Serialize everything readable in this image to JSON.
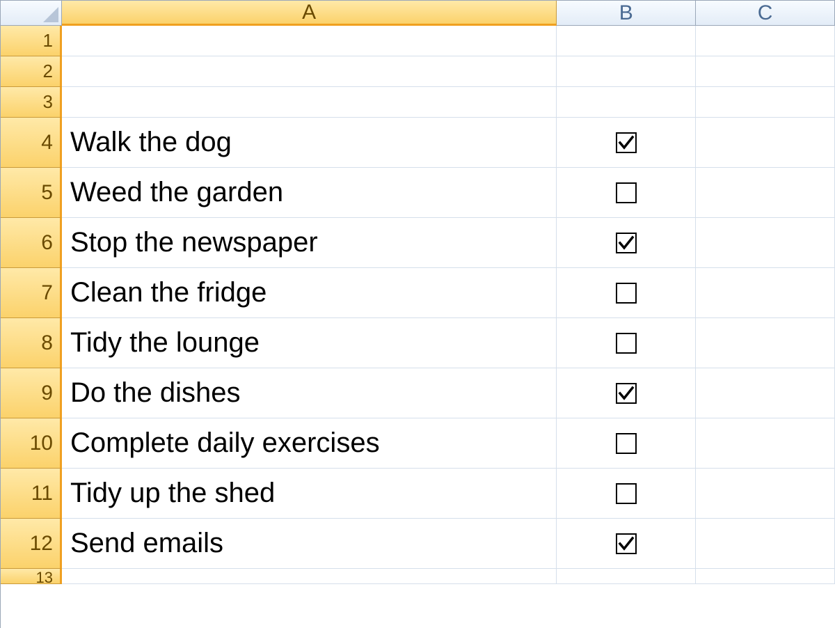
{
  "columns": [
    "A",
    "B",
    "C"
  ],
  "selected_column": "A",
  "rows": [
    {
      "num": 1,
      "task": "",
      "checked": null
    },
    {
      "num": 2,
      "task": "",
      "checked": null
    },
    {
      "num": 3,
      "task": "",
      "checked": null
    },
    {
      "num": 4,
      "task": "Walk the dog",
      "checked": true
    },
    {
      "num": 5,
      "task": "Weed the garden",
      "checked": false
    },
    {
      "num": 6,
      "task": "Stop the newspaper",
      "checked": true
    },
    {
      "num": 7,
      "task": "Clean the fridge",
      "checked": false
    },
    {
      "num": 8,
      "task": "Tidy the lounge",
      "checked": false
    },
    {
      "num": 9,
      "task": "Do the dishes",
      "checked": true
    },
    {
      "num": 10,
      "task": "Complete daily exercises",
      "checked": false
    },
    {
      "num": 11,
      "task": "Tidy up the shed",
      "checked": false
    },
    {
      "num": 12,
      "task": "Send emails",
      "checked": true
    }
  ],
  "next_partial_row": 13
}
